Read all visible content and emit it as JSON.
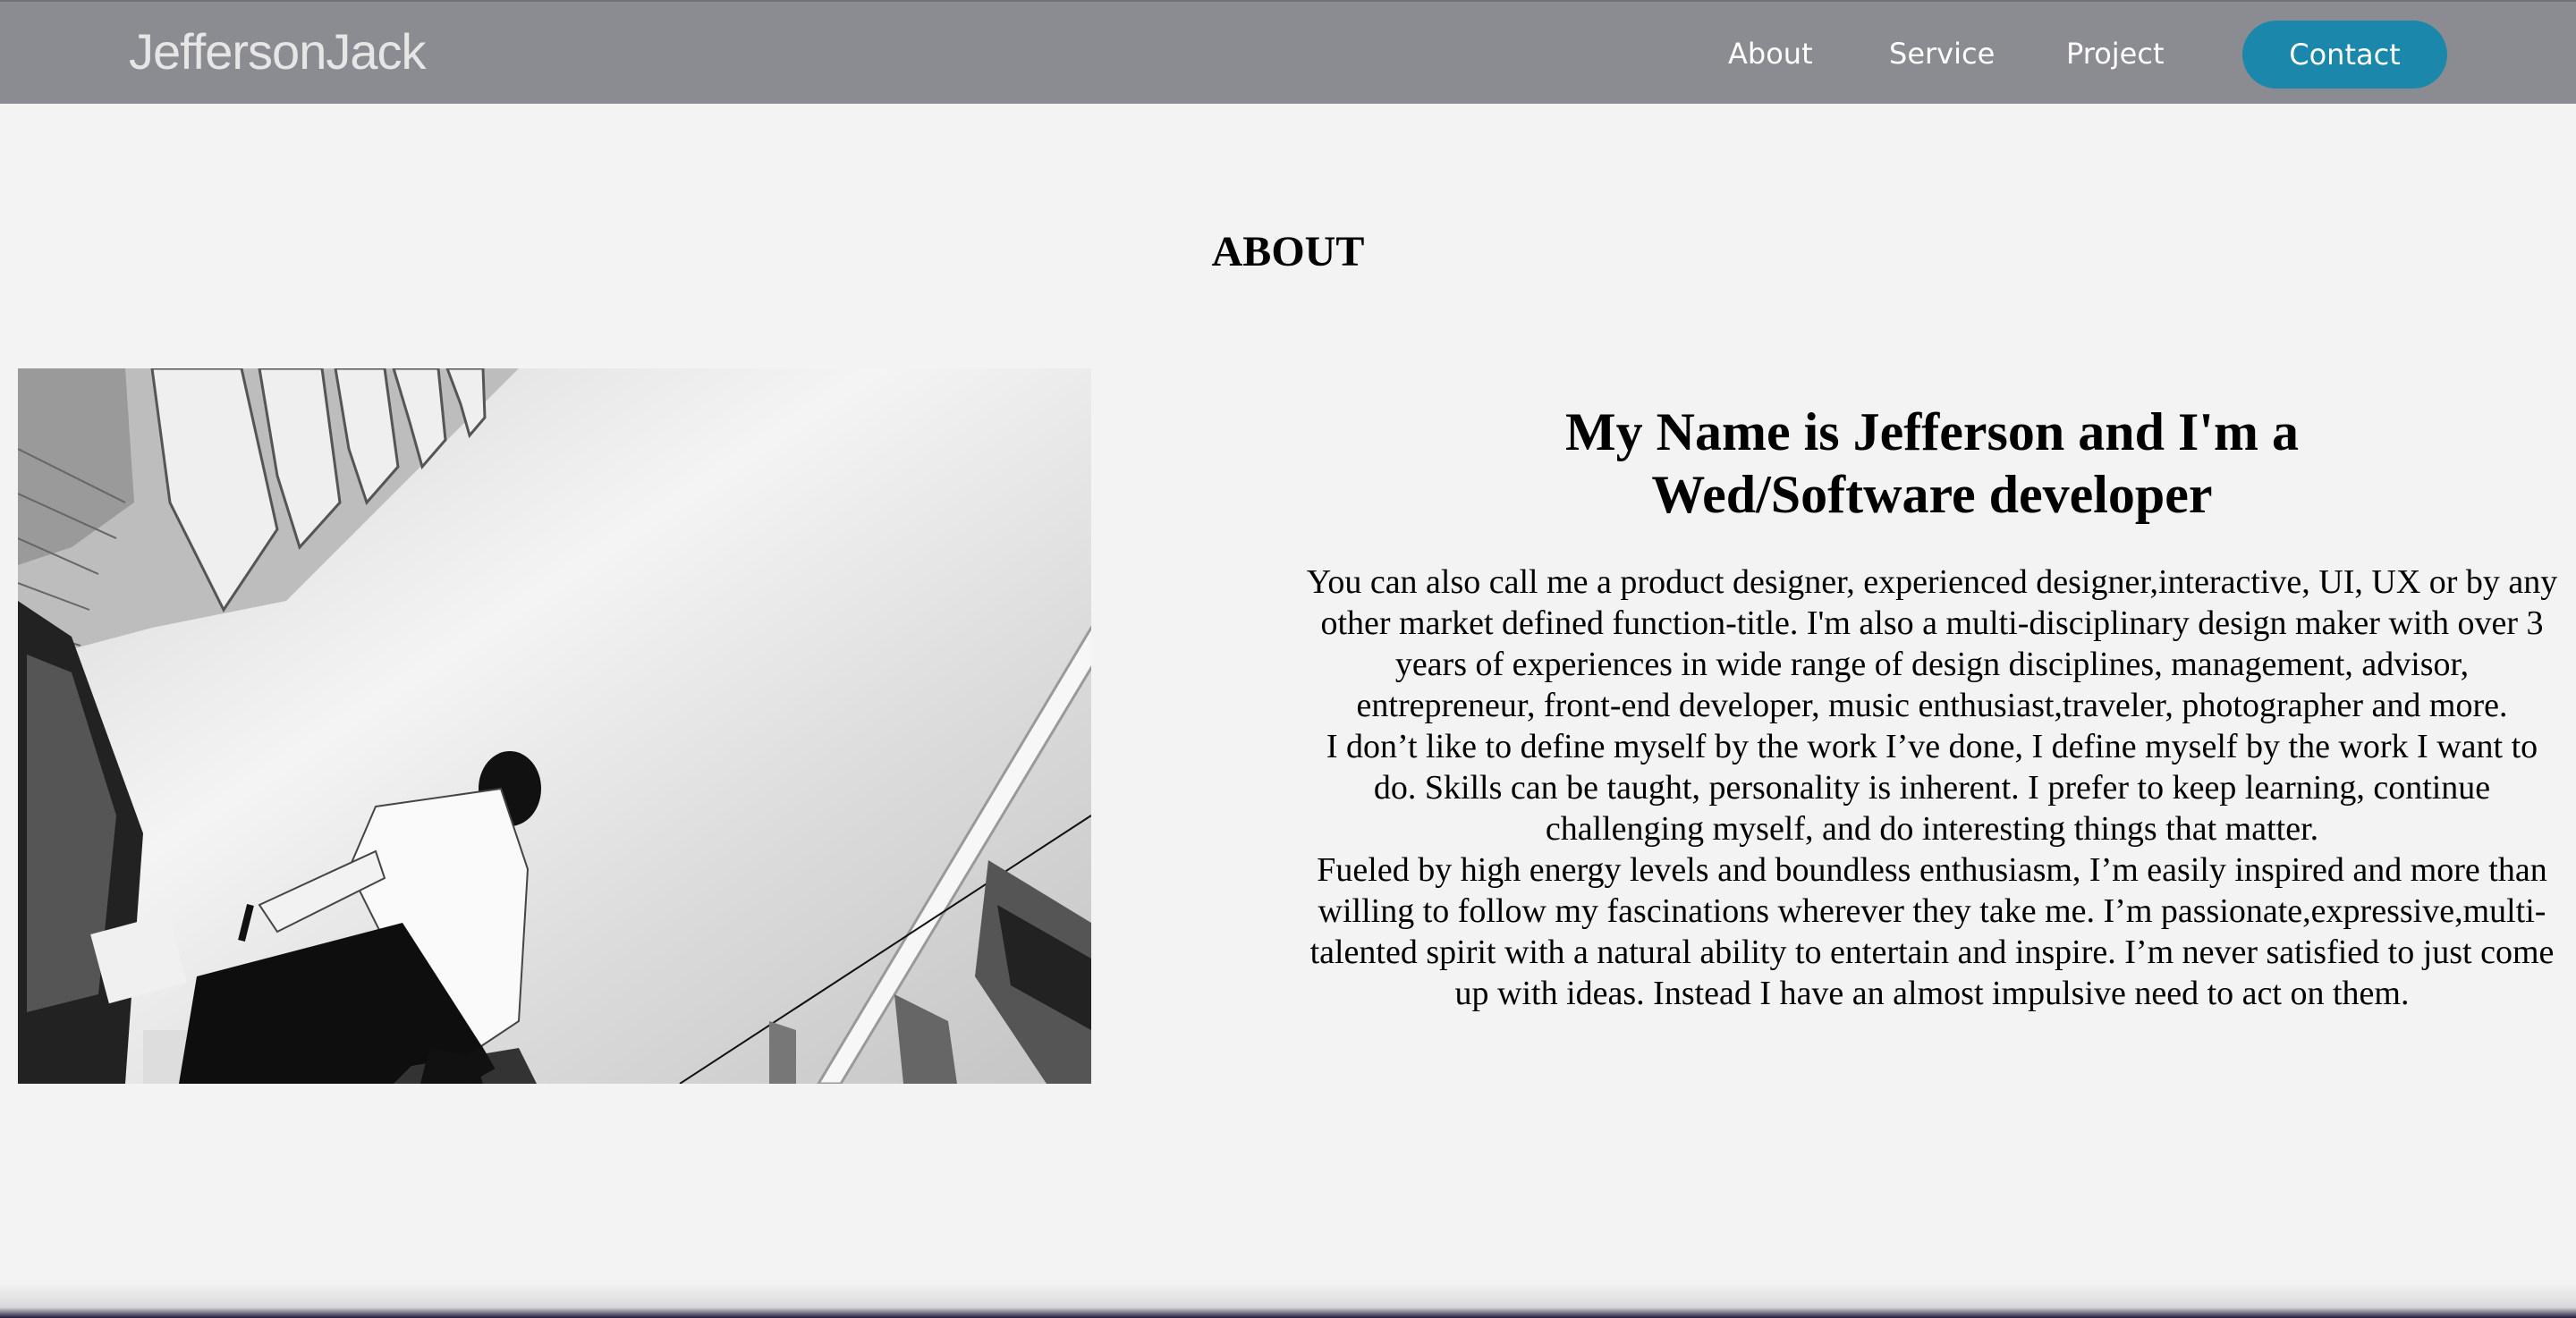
{
  "header": {
    "brand": "JeffersonJack",
    "nav": {
      "about": "About",
      "service": "Service",
      "project": "Project",
      "contact": "Contact"
    }
  },
  "about": {
    "section_title": "ABOUT",
    "headline_line1": "My Name is Jefferson and I'm a",
    "headline_line2": "Wed/Software developer",
    "paragraphs": [
      "You can also call me a product designer, experienced designer,interactive, UI, UX or by any other market defined function-title. I'm also a multi-disciplinary design maker with over 3 years of experiences in wide range of design disciplines, management, advisor, entrepreneur, front-end developer, music enthusiast,traveler, photographer and more.",
      "I don’t like to define myself by the work I’ve done, I define myself by the work I want to do. Skills can be taught, personality is inherent. I prefer to keep learning, continue challenging myself, and do interesting things that matter.",
      "Fueled by high energy levels and boundless enthusiasm, I’m easily inspired and more than willing to follow my fascinations wherever they take me. I’m passionate,expressive,multi-talented spirit with a natural ability to entertain and inspire. I’m never satisfied to just come up with ideas. Instead I have an almost impulsive need to act on them."
    ]
  },
  "colors": {
    "header_bg": "#8a8c91",
    "page_bg": "#f3f3f3",
    "contact_accent": "#1a87ab"
  }
}
